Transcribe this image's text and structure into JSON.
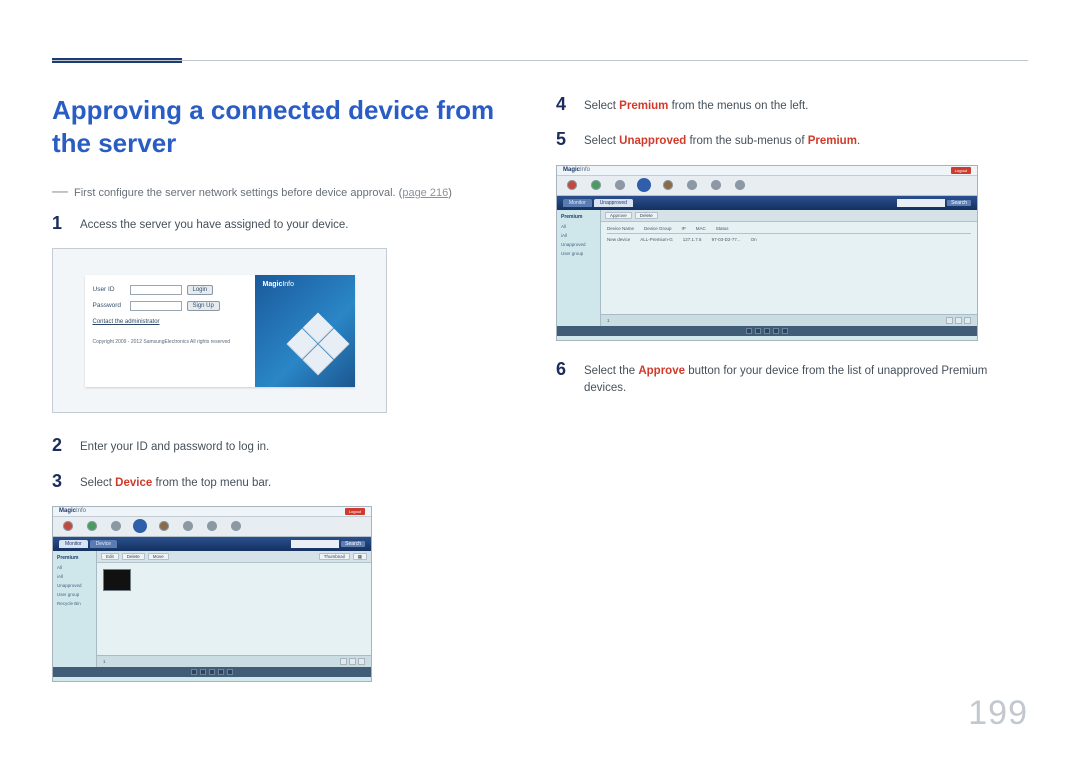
{
  "page_number": "199",
  "title": "Approving a connected device from the server",
  "note": {
    "text": "First configure the server network settings before device approval. (",
    "link_text": "page 216",
    "text_after": ")"
  },
  "left_steps": {
    "s1": {
      "num": "1",
      "text": "Access the server you have assigned to your device."
    },
    "s2": {
      "num": "2",
      "text": "Enter your ID and password to log in."
    },
    "s3": {
      "num": "3",
      "pre": "Select ",
      "kw": "Device",
      "post": " from the top menu bar."
    }
  },
  "right_steps": {
    "s4": {
      "num": "4",
      "pre": "Select ",
      "kw": "Premium",
      "post": " from the menus on the left."
    },
    "s5": {
      "num": "5",
      "pre": "Select ",
      "kw": "Unapproved",
      "post_pre": " from the sub-menus of ",
      "kw2": "Premium",
      "post": "."
    },
    "s6": {
      "num": "6",
      "pre": "Select the ",
      "kw": "Approve",
      "post": " button for your device from the list of unapproved Premium devices."
    }
  },
  "login": {
    "user_label": "User ID",
    "pass_label": "Password",
    "login_btn": "Login",
    "signup_btn": "Sign Up",
    "contact": "Contact the administrator",
    "copyright": "Copyright 2009 - 2012 SamsungElectronics All rights reserved",
    "brand_a": "Magic",
    "brand_b": "Info"
  },
  "app": {
    "brand_a": "Magic",
    "brand_b": "Info",
    "logout": "Logout",
    "tab_monitor": "Monitor",
    "tab_device": "Device",
    "search_btn": "Search",
    "side_header": "Premium",
    "side_all": "All",
    "side_i2": "iAll",
    "side_i3": "Unapproved",
    "side_i4": "User group",
    "side_i5": "Recycle Bin",
    "btn_edit": "Edit",
    "btn_delete": "Delete",
    "btn_move": "Move",
    "btn_thumb": "Thumbnail",
    "foot_count": "1",
    "th1": "Device Name",
    "th2": "Device Group",
    "th3": "IP",
    "th4": "MAC",
    "th5": "Status",
    "td1": "New device",
    "td2": "ALL-Premium-G",
    "td3": "127.1.7.6",
    "td4": "97-03-D2-77...",
    "td5": "On"
  }
}
